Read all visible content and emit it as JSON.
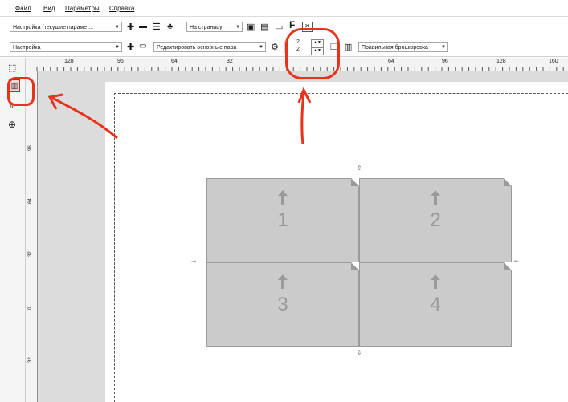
{
  "menu": [
    "Файл",
    "Вид",
    "Параметры",
    "Справка"
  ],
  "toolbar1": {
    "preset": "Настройка (текущие парамет...",
    "zoom_combo": "На страницу",
    "f_label": "F"
  },
  "toolbar2": {
    "preset": "Настройка",
    "edit_combo": "Редактировать основные пара",
    "binding_combo": "Правильная брошюровка",
    "rows_value": "2",
    "cols_value": "2"
  },
  "ruler_h": [
    "128",
    "96",
    "64",
    "32",
    "64",
    "96",
    "128",
    "160"
  ],
  "ruler_v": [
    "96",
    "64",
    "32",
    "0",
    "32"
  ],
  "panels": [
    "1",
    "2",
    "3",
    "4"
  ],
  "colors": {
    "annotation": "#e8331c",
    "panel": "#cbcbcb",
    "workspace": "#dcdcdc"
  }
}
